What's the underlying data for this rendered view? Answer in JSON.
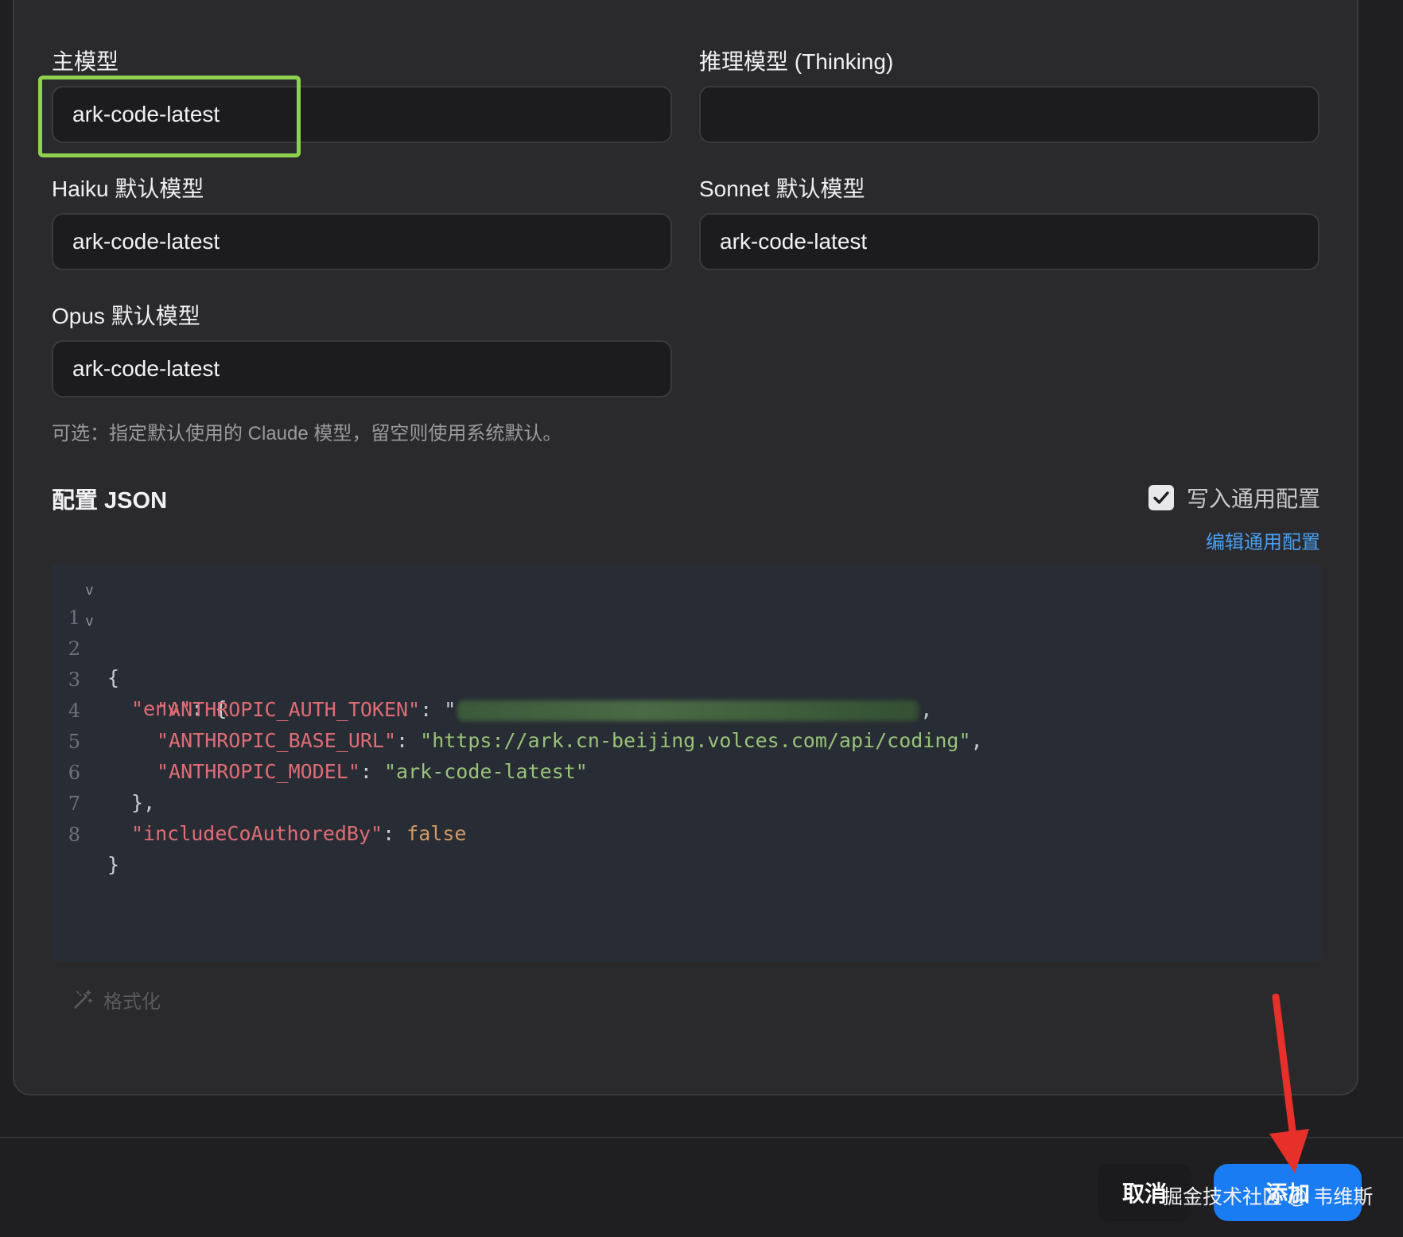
{
  "models": {
    "main": {
      "label": "主模型",
      "value": "ark-code-latest"
    },
    "thinking": {
      "label": "推理模型 (Thinking)",
      "value": ""
    },
    "haiku": {
      "label": "Haiku 默认模型",
      "value": "ark-code-latest"
    },
    "sonnet": {
      "label": "Sonnet 默认模型",
      "value": "ark-code-latest"
    },
    "opus": {
      "label": "Opus 默认模型",
      "value": "ark-code-latest"
    },
    "hint": "可选：指定默认使用的 Claude 模型，留空则使用系统默认。"
  },
  "config": {
    "title": "配置 JSON",
    "write_common": {
      "label": "写入通用配置",
      "checked": true
    },
    "edit_common_link": "编辑通用配置",
    "format_label": "格式化"
  },
  "editor": {
    "line_numbers": [
      "1",
      "2",
      "3",
      "4",
      "5",
      "6",
      "7",
      "8"
    ],
    "lines": {
      "l1": "{",
      "l2_key": "\"env\"",
      "l2_rest": ": {",
      "l3_key": "\"ANTHROPIC_AUTH_TOKEN\"",
      "l3_rest": ": \"",
      "l3_end": ",",
      "l4_key": "\"ANTHROPIC_BASE_URL\"",
      "l4_sep": ": ",
      "l4_val": "\"https://ark.cn-beijing.volces.com/api/coding\"",
      "l4_end": ",",
      "l5_key": "\"ANTHROPIC_MODEL\"",
      "l5_sep": ": ",
      "l5_val": "\"ark-code-latest\"",
      "l6": "},",
      "l7_key": "\"includeCoAuthoredBy\"",
      "l7_sep": ": ",
      "l7_val": "false",
      "l8": "}"
    }
  },
  "footer": {
    "cancel_label": "取消",
    "add_label": "添加",
    "watermark": "掘金技术社区 @ 韦维斯"
  },
  "colors": {
    "accent_blue": "#1a7cf2",
    "highlight_green": "#8fd14f",
    "arrow_red": "#e8302a"
  }
}
